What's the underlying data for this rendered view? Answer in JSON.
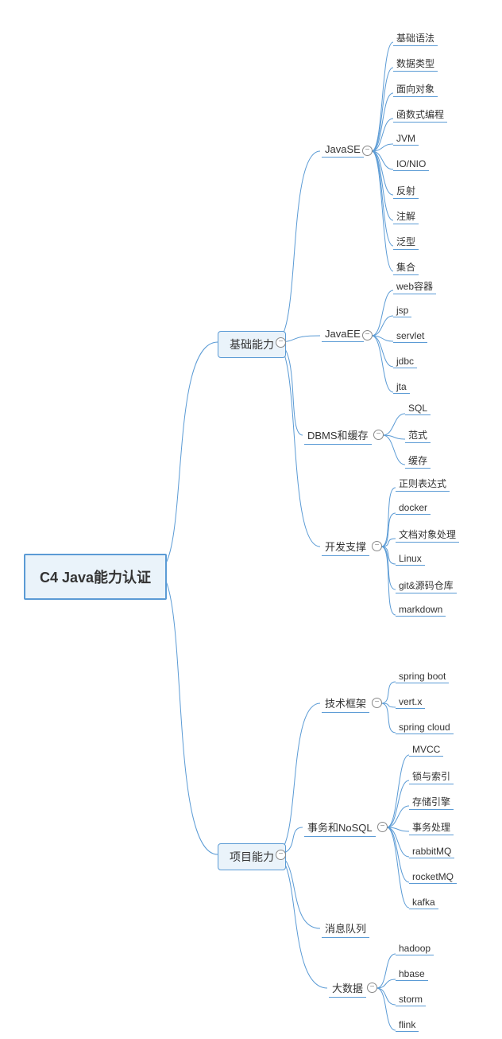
{
  "root": "C4 Java能力认证",
  "branches": {
    "basic": "基础能力",
    "project": "项目能力"
  },
  "basic": {
    "javase": {
      "label": "JavaSE",
      "items": [
        "基础语法",
        "数据类型",
        "面向对象",
        "函数式编程",
        "JVM",
        "IO/NIO",
        "反射",
        "注解",
        "泛型",
        "集合"
      ]
    },
    "javaee": {
      "label": "JavaEE",
      "items": [
        "web容器",
        "jsp",
        "servlet",
        "jdbc",
        "jta"
      ]
    },
    "dbms": {
      "label": "DBMS和缓存",
      "items": [
        "SQL",
        "范式",
        "缓存"
      ]
    },
    "devsupport": {
      "label": "开发支撑",
      "items": [
        "正则表达式",
        "docker",
        "文档对象处理",
        "Linux",
        "git&源码仓库",
        "markdown"
      ]
    }
  },
  "project": {
    "framework": {
      "label": "技术框架",
      "items": [
        "spring boot",
        "vert.x",
        "spring cloud"
      ]
    },
    "transaction": {
      "label": "事务和NoSQL",
      "items": [
        "MVCC",
        "锁与索引",
        "存储引擎",
        "事务处理",
        "rabbitMQ",
        "rocketMQ",
        "kafka"
      ]
    },
    "mq": {
      "label": "消息队列",
      "items": []
    },
    "bigdata": {
      "label": "大数据",
      "items": [
        "hadoop",
        "hbase",
        "storm",
        "flink"
      ]
    }
  }
}
